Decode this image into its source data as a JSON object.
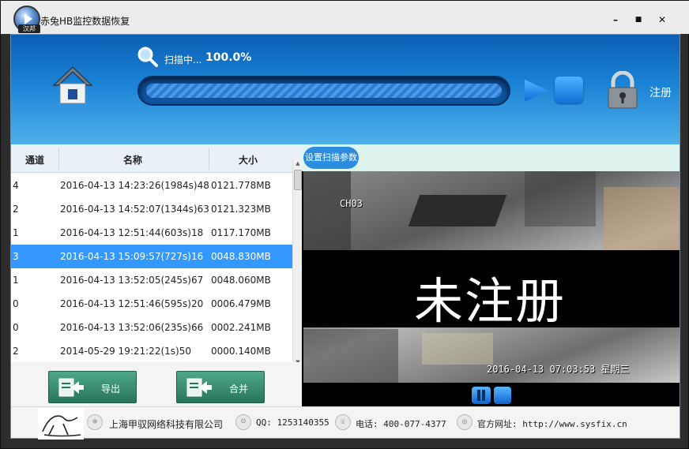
{
  "window": {
    "title": "赤兔HB监控数据恢复",
    "logo_tag": "汉邦",
    "min_label": "–",
    "max_label": "■",
    "close_label": "✕"
  },
  "header": {
    "scan_label": "扫描中...",
    "scan_percent": "100.0%",
    "progress": 1.0,
    "register_label": "注册"
  },
  "list": {
    "columns": [
      "通道",
      "名称",
      "大小"
    ],
    "rows": [
      {
        "channel": "4",
        "name": "2016-04-13 14:23:26(1984s)48",
        "size": "0121.778MB",
        "selected": false
      },
      {
        "channel": "2",
        "name": "2016-04-13 14:52:07(1344s)63",
        "size": "0121.323MB",
        "selected": false
      },
      {
        "channel": "1",
        "name": "2016-04-13 12:51:44(603s)18",
        "size": "0117.170MB",
        "selected": false
      },
      {
        "channel": "3",
        "name": "2016-04-13 15:09:57(727s)16",
        "size": "0048.830MB",
        "selected": true
      },
      {
        "channel": "1",
        "name": "2016-04-13 13:52:05(245s)67",
        "size": "0048.060MB",
        "selected": false
      },
      {
        "channel": "0",
        "name": "2016-04-13 12:51:46(595s)20",
        "size": "0006.479MB",
        "selected": false
      },
      {
        "channel": "0",
        "name": "2016-04-13 13:52:06(235s)66",
        "size": "0002.241MB",
        "selected": false
      },
      {
        "channel": "2",
        "name": "2014-05-29 19:21:22(1s)50",
        "size": "0000.140MB",
        "selected": false
      }
    ]
  },
  "actions": {
    "export_label": "导出",
    "merge_label": "合并"
  },
  "preview": {
    "tab_label": "设置扫描参数",
    "camera_label": "CH03",
    "watermark": "未注册",
    "timestamp": "2016-04-13 07:03:53 星期三"
  },
  "footer": {
    "company": "上海甲驭网络科技有限公司",
    "qq": "QQ: 1253140355",
    "phone": "电话: 400-077-4377",
    "website": "官方网址: http://www.sysfix.cn"
  },
  "colors": {
    "header_top": "#0a5fb4",
    "header_bottom": "#4fb0ea",
    "selected_row": "#3399ff",
    "button_green": "#277559"
  }
}
